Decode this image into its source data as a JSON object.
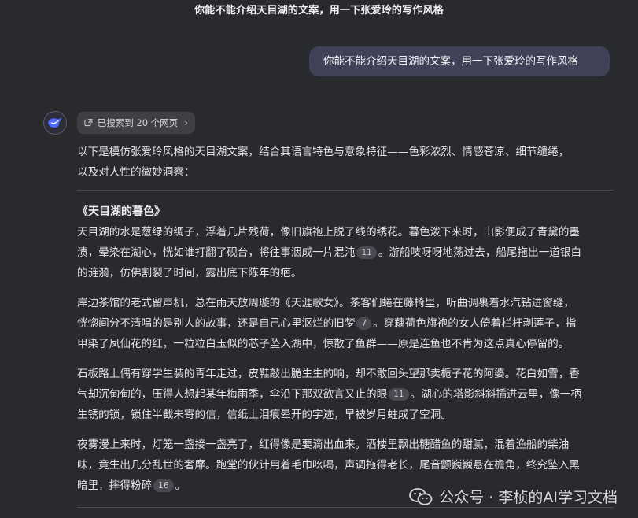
{
  "conversation_title": "你能不能介绍天目湖的文案，用一下张爱玲的写作风格",
  "user_message": "你能不能介绍天目湖的文案，用一下张爱玲的写作风格",
  "search_chip": {
    "label": "已搜索到 20 个网页",
    "chevron": "›"
  },
  "answer": {
    "intro": [
      "以下是模仿张爱玲风格的天目湖文案，结合其语言特色与意象特征——色彩浓烈、情感苍凉、细节缱绻，",
      "以及对人性的微妙洞察："
    ],
    "poem_title": "《天目湖的暮色》",
    "paragraphs": [
      [
        {
          "t": "天目湖的水是葱绿的绸子，浮着几片残荷，像旧旗袍上脱了线的绣花。暮色泼下来时，山影便成了青黛的墨"
        },
        {
          "t": "渍，晕染在湖心，恍如谁打翻了砚台，将往事洇成一片混沌",
          "cite": "11",
          "tail": "。游船吱呀呀地荡过去，船尾拖出一道银白"
        },
        {
          "t": "的涟漪，仿佛割裂了时间，露出底下陈年的疤。"
        }
      ],
      [
        {
          "t": "岸边茶馆的老式留声机，总在雨天放周璇的《天涯歌女》。茶客们蜷在藤椅里，听曲调裹着水汽钻进窗缝，"
        },
        {
          "t": "恍惚间分不清唱的是别人的故事，还是自己心里沤烂的旧梦",
          "cite": "7",
          "tail": "。穿藕荷色旗袍的女人倚着栏杆剥莲子，指"
        },
        {
          "t": "甲染了凤仙花的红，一粒粒白玉似的芯子坠入湖中，惊散了鱼群——原是连鱼也不肯为这点真心停留的。"
        }
      ],
      [
        {
          "t": "石板路上偶有穿学生装的青年走过，皮鞋敲出脆生生的响，却不敢回头望那卖栀子花的阿婆。花白如雪，香"
        },
        {
          "t": "气却沉甸甸的，压得人想起某年梅雨季，伞沿下那双欲言又止的眼",
          "cite": "11",
          "tail": "。湖心的塔影斜斜插进云里，像一柄"
        },
        {
          "t": "生锈的锁，锁住半截未寄的信，信纸上泪痕晕开的字迹，早被岁月蛀成了空洞。"
        }
      ],
      [
        {
          "t": "夜雾漫上来时，灯笼一盏接一盏亮了，红得像是要滴出血来。酒楼里飘出糖醋鱼的甜腻，混着渔船的柴油"
        },
        {
          "t": "味，竟生出几分乱世的奢靡。跑堂的伙计用着毛巾吆喝，声调拖得老长，尾音颤巍巍悬在檐角，终究坠入黑"
        },
        {
          "t": "暗里，摔得粉碎",
          "cite": "16",
          "tail": "。"
        }
      ]
    ]
  },
  "watermark": {
    "text": "公众号 · 李桢的AI学习文档"
  },
  "icons": {
    "avatar": "deepseek-whale-icon",
    "search": "web-search-icon",
    "watermark": "wechat-icon"
  },
  "colors": {
    "background": "#292a2d",
    "user_bubble": "#414158",
    "accent_blue": "#4d6bfe",
    "chip": "#3f4045"
  }
}
